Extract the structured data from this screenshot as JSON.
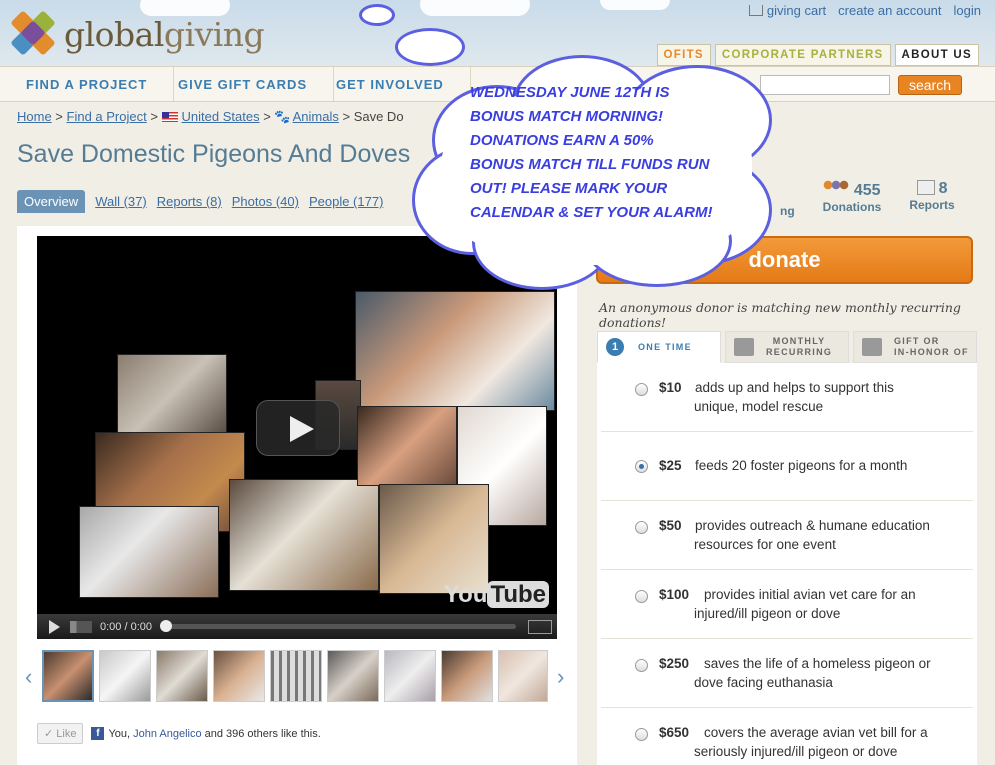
{
  "header": {
    "logo_part1": "global",
    "logo_part2": "giving",
    "links": {
      "cart": "giving cart",
      "create_account": "create an account",
      "login": "login"
    },
    "top_tabs": {
      "nonprofits": "OFITS",
      "partners": "CORPORATE PARTNERS",
      "about": "ABOUT US"
    }
  },
  "nav": {
    "items": [
      "FIND A PROJECT",
      "GIVE GIFT CARDS",
      "GET INVOLVED"
    ],
    "search_label": "search"
  },
  "breadcrumb": {
    "home": "Home",
    "find": "Find a Project",
    "country": "United States",
    "category": "Animals",
    "current": "Save Do"
  },
  "page_title": "Save Domestic Pigeons And Doves",
  "tabs": [
    "Overview",
    "Wall (37)",
    "Reports (8)",
    "Photos (40)",
    "People (177)"
  ],
  "video": {
    "time": "0:00 / 0:00",
    "brand_you": "You",
    "brand_tube": "Tube"
  },
  "like": {
    "button": "Like",
    "text_pre": "You,",
    "name": "John Angelico",
    "text_post": "and 396 others like this."
  },
  "stats": {
    "partial_label": "ng",
    "donations_num": "455",
    "donations_label": "Donations",
    "reports_num": "8",
    "reports_label": "Reports"
  },
  "donate": {
    "button": "donate",
    "anon_note": "An anonymous donor is matching new monthly recurring donations!",
    "tabs": {
      "one_time_num": "1",
      "one_time": "ONE TIME",
      "monthly_1": "MONTHLY",
      "monthly_2": "RECURRING",
      "gift_1": "GIFT OR",
      "gift_2": "IN-HONOR OF"
    },
    "options": [
      {
        "amount": "$10",
        "line1": "adds up and helps to support this",
        "line2": "unique, model rescue",
        "selected": false
      },
      {
        "amount": "$25",
        "line1": "feeds 20 foster pigeons for a month",
        "line2": "",
        "selected": true
      },
      {
        "amount": "$50",
        "line1": "provides outreach & humane education",
        "line2": "resources for one event",
        "selected": false
      },
      {
        "amount": "$100",
        "line1": "provides initial avian vet care for an",
        "line2": "injured/ill pigeon or dove",
        "selected": false
      },
      {
        "amount": "$250",
        "line1": "saves the life of a homeless pigeon or",
        "line2": "dove facing euthanasia",
        "selected": false
      },
      {
        "amount": "$650",
        "line1": "covers the average avian vet bill for a",
        "line2": "seriously injured/ill pigeon or dove",
        "selected": false
      }
    ]
  },
  "announcement": {
    "lines": [
      "WEDNESDAY JUNE 12TH IS",
      "BONUS MATCH MORNING!",
      "DONATIONS EARN A 50%",
      "BONUS MATCH TILL FUNDS RUN",
      "OUT! PLEASE MARK YOUR",
      "CALENDAR & SET YOUR ALARM!"
    ]
  },
  "colors": {
    "accent_blue": "#557c93",
    "orange": "#e47a16",
    "cloud_text": "#3a3ee0"
  }
}
